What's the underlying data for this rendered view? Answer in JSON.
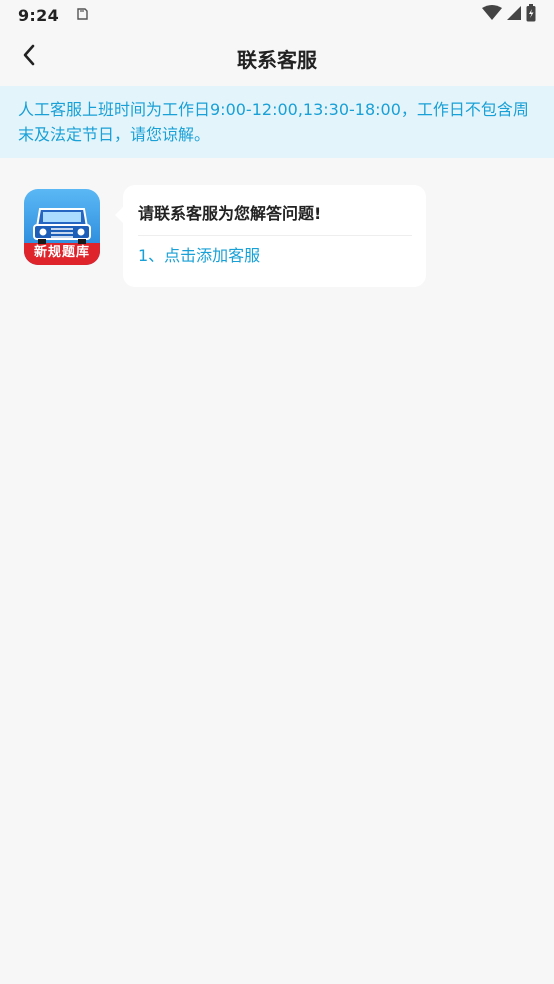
{
  "status_bar": {
    "time": "9:24"
  },
  "header": {
    "title": "联系客服"
  },
  "notice": {
    "text": "人工客服上班时间为工作日9:00-12:00,13:30-18:00，工作日不包含周末及法定节日，请您谅解。"
  },
  "chat": {
    "avatar_text": "新规题库",
    "heading": "请联系客服为您解答问题!",
    "options": [
      "1、点击添加客服"
    ]
  },
  "colors": {
    "accent": "#19a0d6",
    "notice_bg": "#e4f4fb",
    "page_bg": "#f7f7f7",
    "avatar_red": "#e0242b",
    "avatar_blue": "#2a8ee0"
  }
}
